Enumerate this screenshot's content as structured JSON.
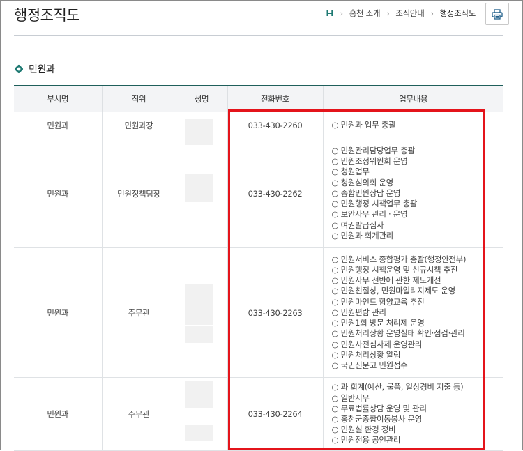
{
  "header": {
    "title": "행정조직도",
    "breadcrumb": [
      "홍천 소개",
      "조직안내",
      "행정조직도"
    ],
    "home_icon": "home-icon",
    "print_icon": "print-icon"
  },
  "section": {
    "title": "민원과",
    "icon": "diamond-bullet-icon"
  },
  "table": {
    "headers": [
      "부서명",
      "직위",
      "성명",
      "전화번호",
      "업무내용"
    ],
    "rows": [
      {
        "dept": "민원과",
        "position": "민원과장",
        "name": "",
        "phone": "033-430-2260",
        "duties": [
          "○ 민원과 업무 총괄"
        ]
      },
      {
        "dept": "민원과",
        "position": "민원정책팀장",
        "name": "",
        "phone": "033-430-2262",
        "duties": [
          "○ 민원관리담당업무 총괄",
          "○ 민원조정위원회 운영",
          "○ 청원업무",
          "○ 청원심의회 운영",
          "○ 종합민원상담 운영",
          "○ 민원행정 시책업무 총괄",
          "○ 보안사무 관리 · 운영",
          "○ 여권발급심사",
          "○ 민원과 회계관리"
        ]
      },
      {
        "dept": "민원과",
        "position": "주무관",
        "name": "",
        "phone": "033-430-2263",
        "duties": [
          "○ 민원서비스 종합평가 총괄(행정안전부)",
          "○ 민원행정 시책운영 및 신규시책 추진",
          "○ 민원사무 전반에 관한 제도개선",
          "○ 민원친절상, 민원마일리지제도 운영",
          "○ 민원마인드 함양교육 추진",
          "○ 민원편람 관리",
          "○ 민원1회 방문 처리제 운영",
          "○ 민원처리상황 운영실태 확인·점검·관리",
          "○ 민원사전심사제 운영관리",
          "○ 민원처리상황 알림",
          "○ 국민신문고 민원접수"
        ]
      },
      {
        "dept": "민원과",
        "position": "주무관",
        "name": "",
        "phone": "033-430-2264",
        "duties": [
          "○ 과 회계(예산, 물품, 일상경비 지출 등)",
          "○ 일반서무",
          "○ 무료법률상담 운영 및 관리",
          "○ 홍천군종합이동봉사 운영",
          "○ 민원실 환경 정비",
          "○ 민원전용 공인관리"
        ]
      }
    ]
  },
  "colors": {
    "accent": "#1f5f5b",
    "header_bg": "#f3f4f6",
    "highlight": "#e4141b"
  }
}
